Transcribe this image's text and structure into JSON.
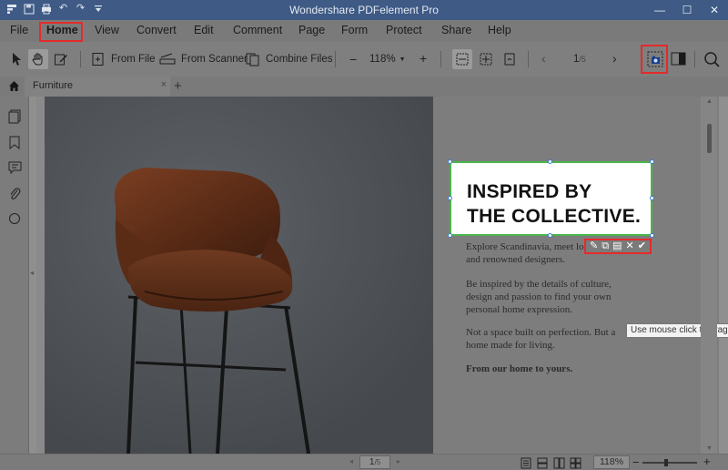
{
  "window": {
    "title": "Wondershare PDFelement Pro",
    "controls": {
      "minimize": "—",
      "maximize": "☐",
      "close": "✕"
    }
  },
  "menu": {
    "items": [
      "File",
      "Home",
      "View",
      "Convert",
      "Edit",
      "Comment",
      "Page",
      "Form",
      "Protect",
      "Share",
      "Help"
    ],
    "active": "Home"
  },
  "toolbar": {
    "from_file": "From File",
    "from_scanner": "From Scanner",
    "combine_files": "Combine Files",
    "zoom_minus": "−",
    "zoom_value": "118%",
    "zoom_plus": "+",
    "page_prev": "‹",
    "page_current": "1",
    "page_total": "/5",
    "page_next": "›"
  },
  "tab": {
    "label": "Furniture",
    "close": "×",
    "add": "+"
  },
  "document": {
    "headline_line1": "INSPIRED BY",
    "headline_line2": "THE COLLECTIVE.",
    "para1_line1": "Explore Scandinavia, meet loc",
    "para1_line2": "and renowned designers.",
    "para2_line1": "Be inspired by the details of culture,",
    "para2_line2": "design and passion to find your own",
    "para2_line3": "personal home expression.",
    "para3_line1": "Not a space built on perfection. But a",
    "para3_line2": "home made for living.",
    "para4": "From our home to yours."
  },
  "tooltip": "Use mouse click to drag the",
  "status": {
    "page_current": "1",
    "page_total": "/5",
    "zoom": "118%",
    "zoom_minus": "−",
    "zoom_plus": "+"
  },
  "colors": {
    "highlight_red": "#e52a2a",
    "selection_green": "#49b54b",
    "titlebar_blue": "#3e5a85"
  }
}
